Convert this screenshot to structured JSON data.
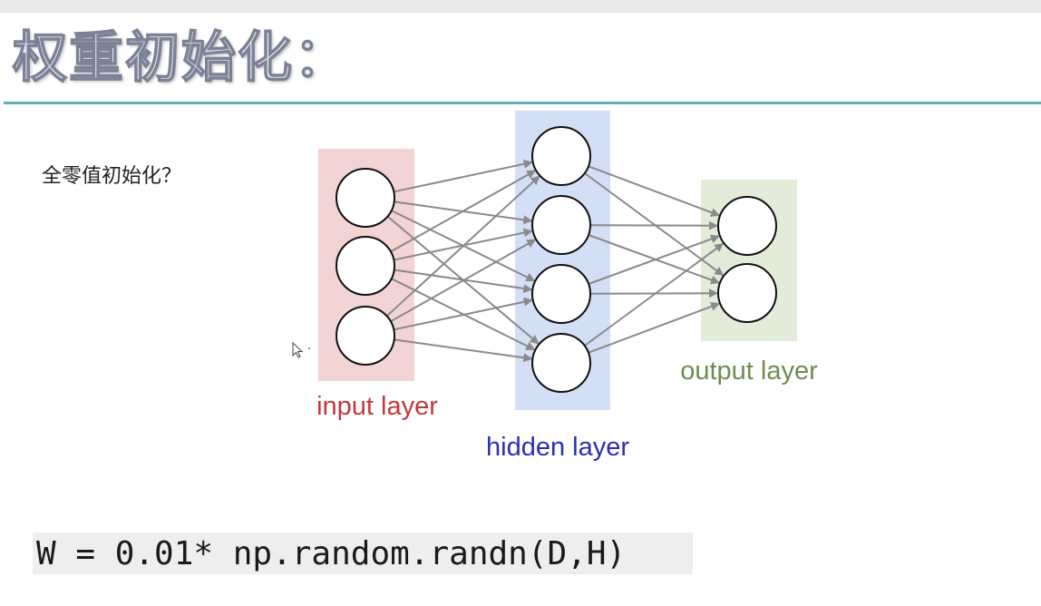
{
  "slide": {
    "title": "权重初始化：",
    "question": "全零值初始化？",
    "code": "W = 0.01* np.random.randn(D,H)"
  },
  "diagram": {
    "layers": [
      {
        "id": "input",
        "label": "input layer",
        "nodes": 3,
        "label_color": "#c0393f",
        "band_color": "#f2d4d4"
      },
      {
        "id": "hidden",
        "label": "hidden layer",
        "nodes": 4,
        "label_color": "#2a2fb8",
        "band_color": "#d3dff5"
      },
      {
        "id": "output",
        "label": "output layer",
        "nodes": 2,
        "label_color": "#6b8e4e",
        "band_color": "#e3ecd9"
      }
    ],
    "edge_color": "#8a8a8a",
    "accent_color": "#5fb0b7"
  },
  "icons": {
    "cursor": "mouse-pointer-icon"
  }
}
